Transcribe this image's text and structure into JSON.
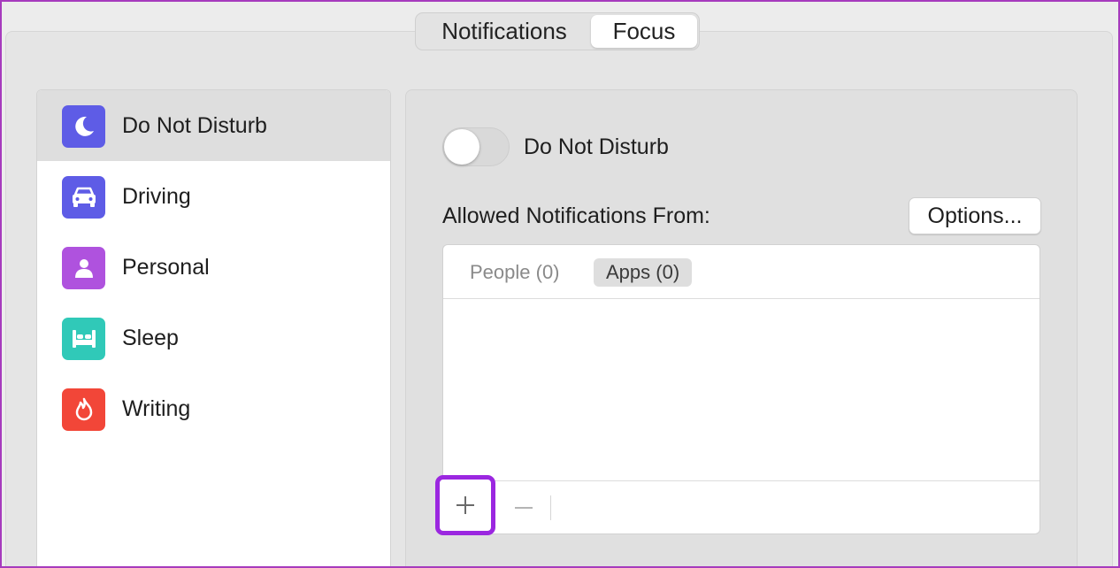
{
  "segmented": {
    "notifications_label": "Notifications",
    "focus_label": "Focus",
    "selected": "Focus"
  },
  "sidebar": {
    "items": [
      {
        "label": "Do Not Disturb",
        "icon": "moon-icon",
        "color": "#5e5ce6",
        "selected": true
      },
      {
        "label": "Driving",
        "icon": "car-icon",
        "color": "#5e5ce6",
        "selected": false
      },
      {
        "label": "Personal",
        "icon": "person-icon",
        "color": "#af52de",
        "selected": false
      },
      {
        "label": "Sleep",
        "icon": "bed-icon",
        "color": "#30c9b8",
        "selected": false
      },
      {
        "label": "Writing",
        "icon": "flame-icon",
        "color": "#f24638",
        "selected": false
      }
    ]
  },
  "main": {
    "toggle_label": "Do Not Disturb",
    "toggle_on": false,
    "allowed_label": "Allowed Notifications From:",
    "options_label": "Options...",
    "tabs": [
      {
        "label": "People (0)",
        "selected": false
      },
      {
        "label": "Apps (0)",
        "selected": true
      }
    ],
    "add_symbol": "+",
    "remove_symbol": "−"
  },
  "colors": {
    "highlight": "#9b27e0",
    "frame": "#a63bbd"
  }
}
